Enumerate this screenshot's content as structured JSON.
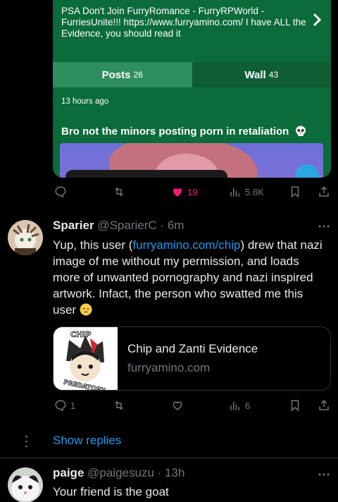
{
  "embed": {
    "description": "PSA Don't Join FurryRomance - FurryRPWorld - FurriesUnite!!! https://www.furryamino.com/ I have ALL the Evidence, you should read it",
    "tabs": [
      {
        "label": "Posts",
        "count": "26"
      },
      {
        "label": "Wall",
        "count": "43"
      }
    ],
    "time": "13 hours ago",
    "post_title": "Bro not the minors posting porn in retaliation"
  },
  "first_actions": {
    "likes": "19",
    "views": "5.8K"
  },
  "reply": {
    "name": "Sparier",
    "handle": "@SparierC",
    "separator": "·",
    "time": "6m",
    "text_before_link": "Yup, this user (",
    "link": "furryamino.com/chip",
    "text_after_link": ") drew that nazi image of me without my permission, and loads more of unwanted pornography and nazi inspired artwork. Infact, the person who swatted me this user",
    "card": {
      "title": "Chip and Zanti Evidence",
      "domain": "furryamino.com",
      "thumb_top_text": "CHIP",
      "thumb_bottom_text": "PREDATORY"
    },
    "actions": {
      "replies": "1",
      "views": "6"
    }
  },
  "show_replies": "Show replies",
  "next_reply": {
    "name": "paige",
    "handle": "@paigesuzu",
    "separator": "·",
    "time": "13h",
    "text": "Your friend is the goat"
  },
  "colors": {
    "accent": "#1d9bf0",
    "like": "#f91880",
    "embed_bg": "#0b6b3a",
    "muted": "#71767b"
  },
  "icons": [
    "chevron-right-icon",
    "skull-icon",
    "reply-icon",
    "retweet-icon",
    "heart-icon",
    "views-icon",
    "bookmark-icon",
    "share-icon",
    "more-icon",
    "pensive-face-icon"
  ]
}
